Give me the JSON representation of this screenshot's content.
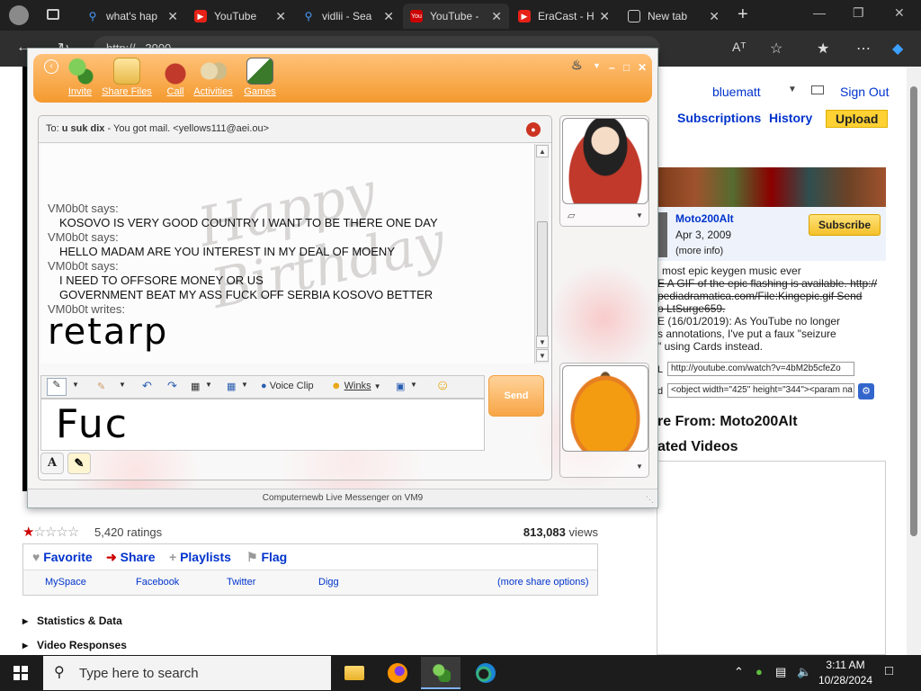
{
  "browser": {
    "tabs": [
      {
        "title": "what's hap",
        "favicon": "search-icon"
      },
      {
        "title": "YouTube",
        "favicon": "youtube-icon"
      },
      {
        "title": "vidlii - Sea",
        "favicon": "search-icon"
      },
      {
        "title": "YouTube -",
        "favicon": "youtube-icon"
      },
      {
        "title": "EraCast - H",
        "favicon": "youtube-icon"
      },
      {
        "title": "New tab",
        "favicon": "newtab-icon"
      }
    ],
    "new_tab": "+",
    "address": "http://...3000...",
    "read_aloud": "Aᵀ"
  },
  "youtube": {
    "user": "bluematt",
    "sign_out": "Sign Out",
    "nav": {
      "subscriptions": "Subscriptions",
      "history": "History",
      "upload": "Upload"
    },
    "channel": {
      "name": "Moto200Alt",
      "date": "Apr 3, 2009",
      "more": "(more info)",
      "subscribe": "Subscribe"
    },
    "description": [
      "most epic keygen music ever",
      "E A GIF of the epic flashing is available. http://",
      "pediadramatica.com/File:Kingepic.gif Send",
      "o LtSurge659.",
      "E (16/01/2019): As YouTube no longer",
      "s annotations, I've put a faux \"seizure",
      "\" using Cards instead."
    ],
    "url_label": "L",
    "url_value": "http://youtube.com/watch?v=4bM2b5cfeZo",
    "embed_label": "d",
    "embed_value": "<object width=\"425\" height=\"344\"><param na",
    "more_from": "re From: Moto200Alt",
    "related": "ated Videos",
    "rating": {
      "count_text": "5,420 ratings",
      "views": "813,083",
      "views_label": "views",
      "stars": 1,
      "stars_max": 5
    },
    "actions": {
      "favorite": "Favorite",
      "share": "Share",
      "playlists": "Playlists",
      "flag": "Flag"
    },
    "share_links": {
      "myspace": "MySpace",
      "facebook": "Facebook",
      "twitter": "Twitter",
      "digg": "Digg",
      "more": "(more share options)"
    },
    "sections": {
      "stats": "Statistics & Data",
      "responses": "Video Responses"
    }
  },
  "messenger": {
    "header": {
      "invite": "Invite",
      "share_files": "Share Files",
      "call": "Call",
      "activities": "Activities",
      "games": "Games"
    },
    "to_label": "To:",
    "to_name": "u suk dix",
    "to_status": " - You got mail.  <yellows111@aei.ou>",
    "watermark": "Happy Birthday",
    "lines": [
      {
        "kind": "who",
        "text": "VM0b0t says:"
      },
      {
        "kind": "msg",
        "text": "KOSOVO  IS VERY GOOD COUNTRY I WANT TO BE THERE ONE DAY"
      },
      {
        "kind": "who",
        "text": "VM0b0t says:"
      },
      {
        "kind": "msg",
        "text": "HELLO MADAM ARE YOU INTEREST IN MY DEAL OF MOENY"
      },
      {
        "kind": "who",
        "text": "VM0b0t says:"
      },
      {
        "kind": "msg",
        "text": "I NEED TO OFFSORE MONEY OR US"
      },
      {
        "kind": "msg",
        "text": "GOVERNMENT BEAT MY ASS FUCK OFF SERBIA KOSOVO BETTER"
      },
      {
        "kind": "who",
        "text": "VM0b0t writes:"
      }
    ],
    "ink_message": "retarp",
    "compose_ink": "Fuc",
    "toolbar": {
      "voice_clip": "Voice Clip",
      "winks": "Winks"
    },
    "send": "Send",
    "mode_text": "A",
    "status_bar": "Computernewb Live Messenger on VM9"
  },
  "taskbar": {
    "search_placeholder": "Type here to search",
    "time": "3:11 AM",
    "date": "10/28/2024"
  },
  "colors": {
    "messenger_orange": "#f49a2f",
    "youtube_link": "#0033cc",
    "upload_yellow": "#ffd133"
  }
}
